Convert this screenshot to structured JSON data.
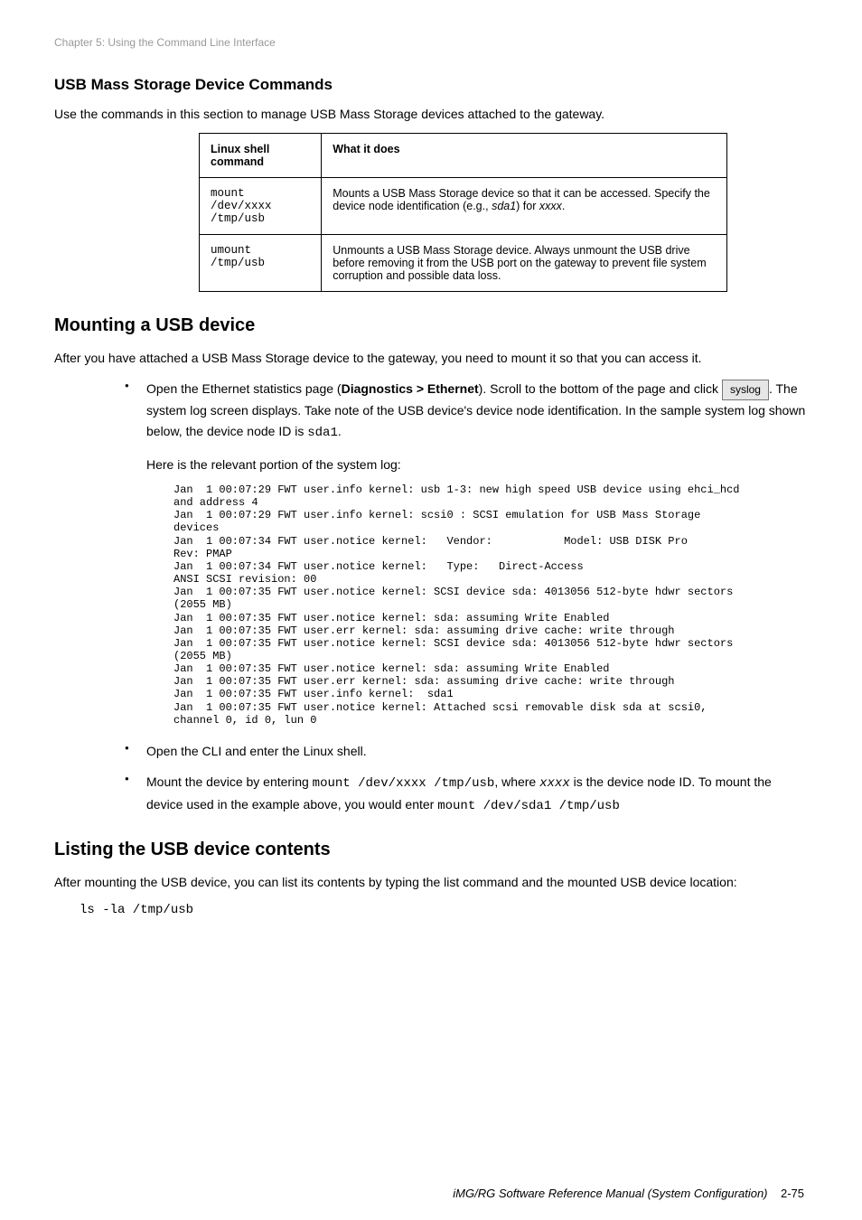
{
  "crumb": "Chapter 5: Using the Command Line Interface",
  "section_title": "USB Mass Storage Device Commands",
  "intro": "Use the commands in this section to manage USB Mass Storage devices attached to the gateway.",
  "table": {
    "headers": [
      "Linux shell command",
      "What it does"
    ],
    "rows": [
      {
        "cmd": "mount /dev/xxxx /tmp/usb",
        "desc_parts": [
          "Mounts a USB Mass Storage device so that it can be accessed. Specify the device node identification (e.g., ",
          "sda1",
          ") for ",
          "xxxx",
          "."
        ]
      },
      {
        "cmd": "umount /tmp/usb",
        "desc": "Unmounts a USB Mass Storage device. Always unmount the USB drive before removing it from the USB port on the gateway to prevent file system corruption and possible data loss."
      }
    ]
  },
  "mount_heading": "Mounting a USB device",
  "mount_intro": "After you have attached a USB Mass Storage device to the gateway, you need to mount it so that you can access it.",
  "steps": {
    "s1": {
      "lead": "Open the Ethernet statistics page (",
      "bold": "Diagnostics > Ethernet",
      "tail": "). Scroll to the bottom of the page and click ",
      "button": "syslog",
      "after": ". The system log screen displays. Take note of the USB device's device node identification. In the sample system log shown below, the device node ID is ",
      "code": "sda1",
      "period": ".",
      "pretext": "Here is the relevant portion of the system log:"
    },
    "log": "Jan  1 00:07:29 FWT user.info kernel: usb 1-3: new high speed USB device using ehci_hcd and address 4\nJan  1 00:07:29 FWT user.info kernel: scsi0 : SCSI emulation for USB Mass Storage devices\nJan  1 00:07:34 FWT user.notice kernel:   Vendor:           Model: USB DISK Pro      Rev: PMAP\nJan  1 00:07:34 FWT user.notice kernel:   Type:   Direct-Access                      ANSI SCSI revision: 00\nJan  1 00:07:35 FWT user.notice kernel: SCSI device sda: 4013056 512-byte hdwr sectors (2055 MB)\nJan  1 00:07:35 FWT user.notice kernel: sda: assuming Write Enabled\nJan  1 00:07:35 FWT user.err kernel: sda: assuming drive cache: write through\nJan  1 00:07:35 FWT user.notice kernel: SCSI device sda: 4013056 512-byte hdwr sectors (2055 MB)\nJan  1 00:07:35 FWT user.notice kernel: sda: assuming Write Enabled\nJan  1 00:07:35 FWT user.err kernel: sda: assuming drive cache: write through\nJan  1 00:07:35 FWT user.info kernel:  sda1\nJan  1 00:07:35 FWT user.notice kernel: Attached scsi removable disk sda at scsi0, channel 0, id 0, lun 0",
    "s2": "Open the CLI and enter the Linux shell.",
    "s3": {
      "lead": "Mount the device by entering ",
      "cmd": "mount /dev/xxxx /tmp/usb",
      "mid": ", where ",
      "arg": "xxxx",
      "mid2": " is the device node ID. To mount the device used in the example above, you would enter ",
      "example": "mount /dev/sda1 /tmp/usb"
    }
  },
  "listing_heading": "Listing the USB device contents",
  "listing_intro": "After mounting the USB device, you can list its contents by typing the list command and the mounted USB device location:",
  "listing_cmd": "ls -la /tmp/usb",
  "pagenum_label": "iMG/RG Software Reference Manual (System Configuration)",
  "pagenum": "2-75"
}
